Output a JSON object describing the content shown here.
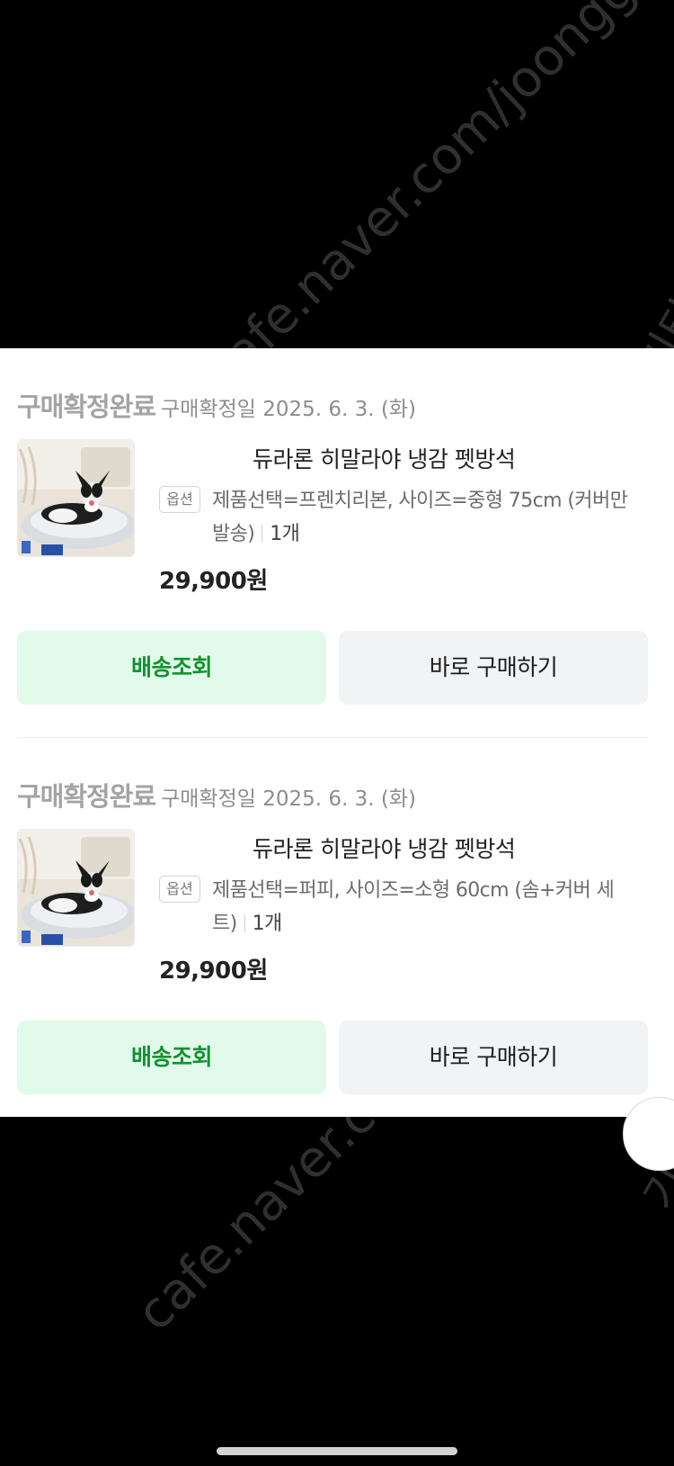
{
  "orders": [
    {
      "status": "구매확정완료",
      "confirm_date": "구매확정일 2025. 6. 3. (화)",
      "product_name": "듀라론 히말라야 냉감 펫방석",
      "option_badge": "옵션",
      "option_text": "제품선택=프렌치리본, 사이즈=중형 75cm (커버만 발송)",
      "quantity": "1개",
      "price": "29,900원",
      "track_button": "배송조회",
      "buy_button": "바로 구매하기"
    },
    {
      "status": "구매확정완료",
      "confirm_date": "구매확정일 2025. 6. 3. (화)",
      "product_name": "듀라론 히말라야 냉감 펫방석",
      "option_badge": "옵션",
      "option_text": "제품선택=퍼피, 사이즈=소형 60cm (솜+커버 세트)",
      "quantity": "1개",
      "price": "29,900원",
      "track_button": "배송조회",
      "buy_button": "바로 구매하기"
    }
  ],
  "watermark": {
    "text_upper": "cafe.naver.com/joonggonara",
    "text_lower": "cafe.naver.com/joonggonara",
    "side_text": "기타"
  },
  "colors": {
    "track_bg": "#e2faea",
    "track_text": "#12922f",
    "buy_bg": "#f2f3f5",
    "status_gray": "#a3a3a3"
  },
  "icons": {
    "product_thumbnail": "dog-on-bed-image",
    "scroll_button": "scroll-top-icon"
  }
}
